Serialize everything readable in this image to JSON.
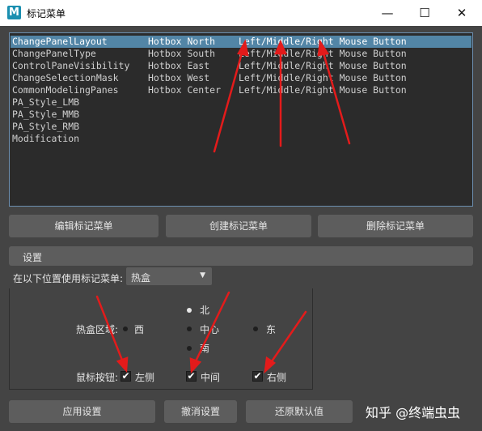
{
  "window": {
    "title": "标记菜单",
    "icon_letter": "M",
    "minimize_glyph": "—",
    "maximize_glyph": "☐",
    "close_glyph": "✕"
  },
  "marking_menus": [
    {
      "name": "ChangePanelLayout",
      "location": "Hotbox North",
      "buttons": "Left/Middle/Right Mouse Button",
      "selected": true
    },
    {
      "name": "ChangePanelType",
      "location": "Hotbox South",
      "buttons": "Left/Middle/Right Mouse Button",
      "selected": false
    },
    {
      "name": "ControlPaneVisibility",
      "location": "Hotbox East",
      "buttons": "Left/Middle/Right Mouse Button",
      "selected": false
    },
    {
      "name": "ChangeSelectionMask",
      "location": "Hotbox West",
      "buttons": "Left/Middle/Right Mouse Button",
      "selected": false
    },
    {
      "name": "CommonModelingPanes",
      "location": "Hotbox Center",
      "buttons": "Left/Middle/Right Mouse Button",
      "selected": false
    },
    {
      "name": "PA_Style_LMB",
      "location": "",
      "buttons": "",
      "selected": false
    },
    {
      "name": "PA_Style_MMB",
      "location": "",
      "buttons": "",
      "selected": false
    },
    {
      "name": "PA_Style_RMB",
      "location": "",
      "buttons": "",
      "selected": false
    },
    {
      "name": "Modification",
      "location": "",
      "buttons": "",
      "selected": false
    }
  ],
  "actions": {
    "edit": "编辑标记菜单",
    "create": "创建标记菜单",
    "delete": "删除标记菜单"
  },
  "settings": {
    "title": "设置",
    "use_label": "在以下位置使用标记菜单:",
    "use_value": "热盒",
    "region_label": "热盒区域:",
    "regions": {
      "north": "北",
      "south": "南",
      "east": "东",
      "west": "西",
      "center": "中心"
    },
    "selected_region": "north",
    "mouse_label": "鼠标按钮:",
    "mouse_buttons": [
      {
        "label": "左侧",
        "checked": true
      },
      {
        "label": "中间",
        "checked": true
      },
      {
        "label": "右侧",
        "checked": true
      }
    ]
  },
  "footer": {
    "apply": "应用设置",
    "cancel": "撤消设置",
    "reset": "还原默认值"
  },
  "watermark": "知乎 @终端虫虫",
  "colors": {
    "background": "#444444",
    "list_background": "#2b2b2b",
    "selection": "#5285a6",
    "button": "#5d5d5d",
    "annotation_arrow": "#e31b1b"
  }
}
